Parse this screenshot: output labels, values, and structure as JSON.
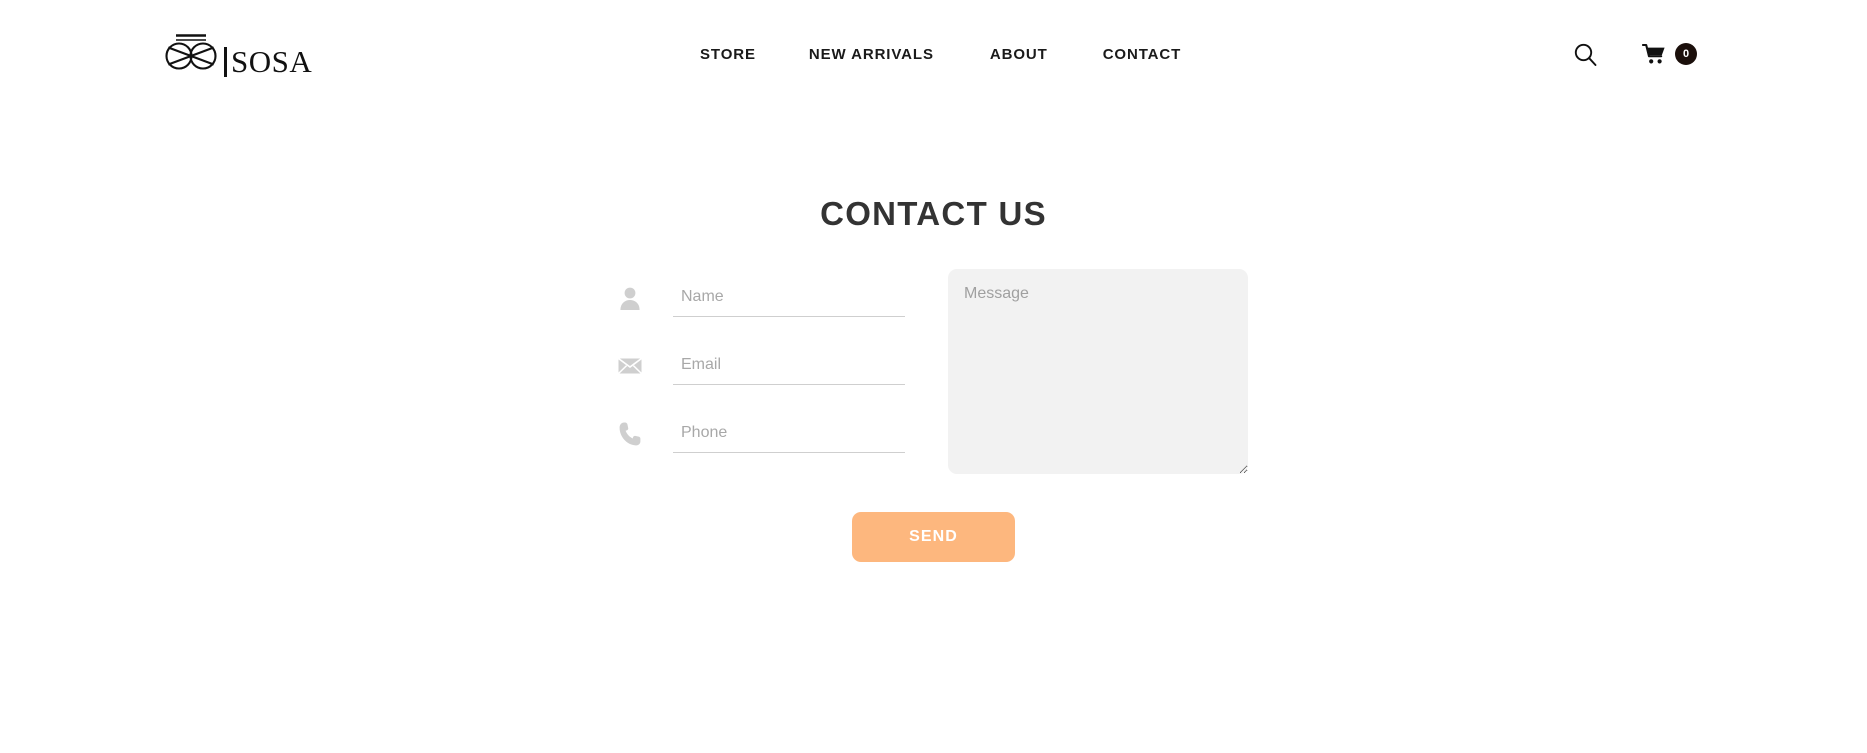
{
  "header": {
    "brand": {
      "logo_icon": "infinity-loop-logo",
      "wordmark": "SOSA"
    },
    "nav": [
      {
        "label": "STORE"
      },
      {
        "label": "NEW ARRIVALS"
      },
      {
        "label": "ABOUT"
      },
      {
        "label": "CONTACT"
      }
    ],
    "actions": {
      "search_icon": "search-icon",
      "cart_icon": "shopping-cart-icon",
      "cart_count": "0"
    }
  },
  "main": {
    "title": "CONTACT US",
    "fields": [
      {
        "icon": "user-icon",
        "placeholder": "Name",
        "value": ""
      },
      {
        "icon": "envelope-icon",
        "placeholder": "Email",
        "value": ""
      },
      {
        "icon": "phone-icon",
        "placeholder": "Phone",
        "value": ""
      }
    ],
    "message": {
      "placeholder": "Message",
      "value": ""
    },
    "submit_label": "SEND"
  },
  "colors": {
    "page_background": "#ffffff",
    "accent_button": "#fdb77e",
    "title_text": "#333333",
    "nav_text": "#1a1a1a",
    "placeholder_text": "#a8a8a8",
    "field_underline": "#cfcfcf",
    "textarea_background": "#f2f2f2",
    "cart_badge_background": "#1b0f0b"
  }
}
